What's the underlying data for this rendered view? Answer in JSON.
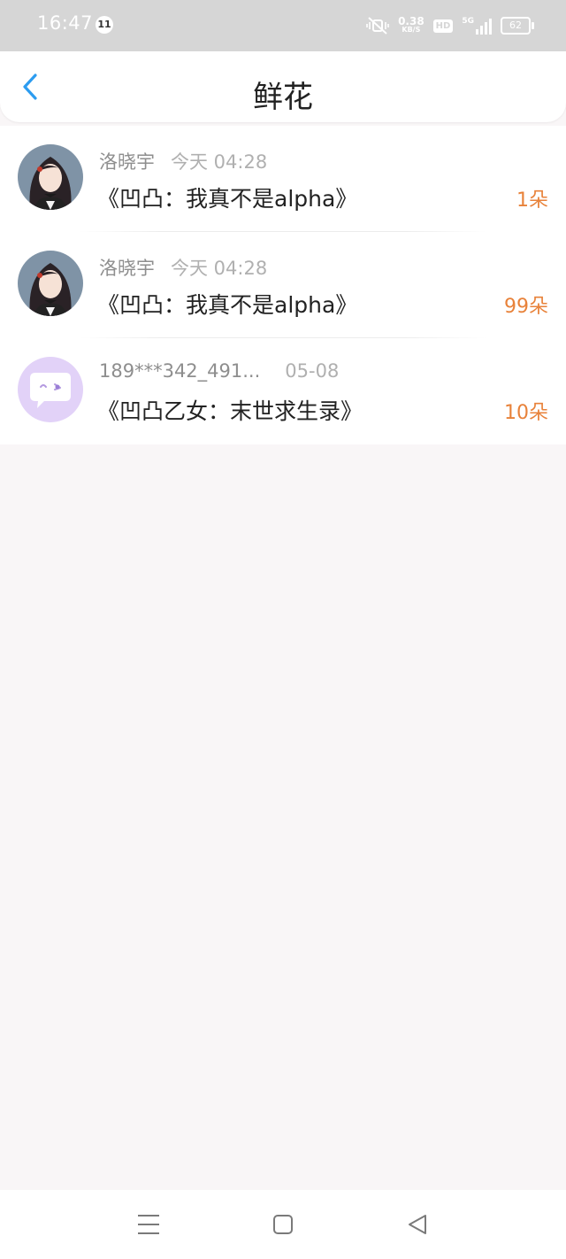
{
  "status_bar": {
    "time": "16:47",
    "notification_count": "11",
    "net_speed_value": "0.38",
    "net_speed_unit": "KB/S",
    "hd_label": "HD",
    "network_type": "5G",
    "battery_level": "62"
  },
  "header": {
    "back_icon": "chevron-left-icon",
    "title": "鲜花"
  },
  "flowers": [
    {
      "user": "洛晓宇",
      "time": "今天 04:28",
      "book": "《凹凸：我真不是alpha》",
      "count": "1朵",
      "avatar": "anime-girl-avatar"
    },
    {
      "user": "洛晓宇",
      "time": "今天 04:28",
      "book": "《凹凸：我真不是alpha》",
      "count": "99朵",
      "avatar": "anime-girl-avatar"
    },
    {
      "user": "189***342_491...",
      "time": "05-08",
      "book": "《凹凸乙女：末世求生录》",
      "count": "10朵",
      "avatar": "chat-bubble-avatar"
    }
  ],
  "nav_bar": {
    "menu_icon": "menu-icon",
    "home_icon": "home-square-icon",
    "back_icon": "back-triangle-icon"
  },
  "colors": {
    "accent_blue": "#2c9cf0",
    "count_orange": "#e8823a",
    "status_bar_bg": "#d6d6d6",
    "page_bg": "#f9f6f7",
    "avatar_purple": "#e2d2f8"
  }
}
